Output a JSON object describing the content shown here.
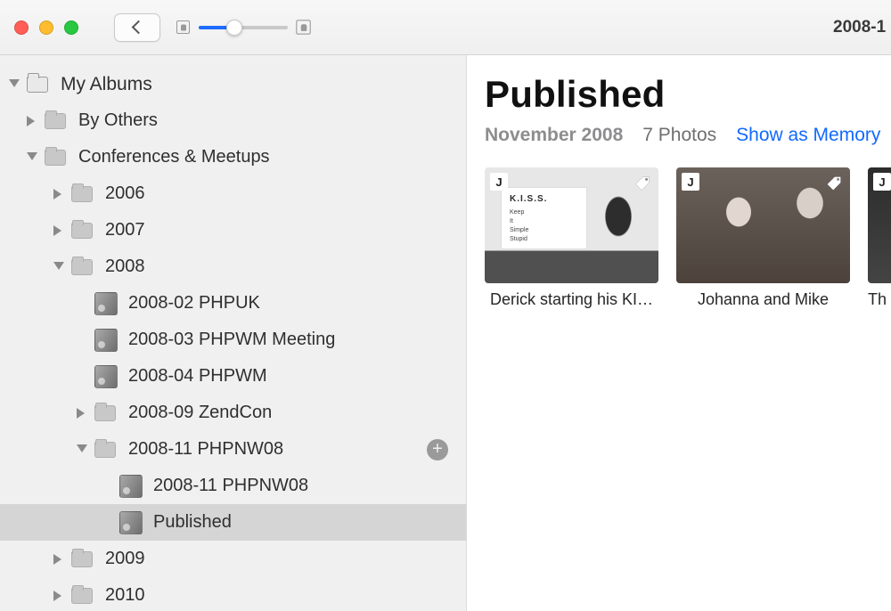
{
  "window": {
    "title_partial": "2008-1",
    "slider_percent": 40
  },
  "sidebar": {
    "header": "My Albums",
    "items": [
      {
        "label": "By Others",
        "indent": 1,
        "disclosure": "right",
        "icon": "folder"
      },
      {
        "label": "Conferences & Meetups",
        "indent": 1,
        "disclosure": "down",
        "icon": "folder"
      },
      {
        "label": "2006",
        "indent": 2,
        "disclosure": "right",
        "icon": "folder"
      },
      {
        "label": "2007",
        "indent": 2,
        "disclosure": "right",
        "icon": "folder"
      },
      {
        "label": "2008",
        "indent": 2,
        "disclosure": "down",
        "icon": "folder"
      },
      {
        "label": "2008-02 PHPUK",
        "indent": 3,
        "disclosure": "none",
        "icon": "album"
      },
      {
        "label": "2008-03 PHPWM Meeting",
        "indent": 3,
        "disclosure": "none",
        "icon": "album"
      },
      {
        "label": "2008-04 PHPWM",
        "indent": 3,
        "disclosure": "none",
        "icon": "album"
      },
      {
        "label": "2008-09 ZendCon",
        "indent": 3,
        "disclosure": "right",
        "icon": "folder"
      },
      {
        "label": "2008-11 PHPNW08",
        "indent": 3,
        "disclosure": "down",
        "icon": "folder",
        "add_button": true
      },
      {
        "label": "2008-11 PHPNW08",
        "indent": 4,
        "disclosure": "none",
        "icon": "album"
      },
      {
        "label": "Published",
        "indent": 4,
        "disclosure": "none",
        "icon": "album",
        "selected": true
      },
      {
        "label": "2009",
        "indent": 2,
        "disclosure": "right",
        "icon": "folder"
      },
      {
        "label": "2010",
        "indent": 2,
        "disclosure": "right",
        "icon": "folder"
      }
    ]
  },
  "album": {
    "title": "Published",
    "date": "November 2008",
    "count_label": "7 Photos",
    "action": "Show as Memory",
    "photos": [
      {
        "caption": "Derick starting his KI…",
        "badge": "J",
        "has_tag": true,
        "slide_title": "K.I.S.S.",
        "slide_lines": [
          "Keep",
          "It",
          "Simple",
          "Stupid"
        ]
      },
      {
        "caption": "Johanna and Mike",
        "badge": "J",
        "has_tag": true
      },
      {
        "caption": "Th",
        "badge": "J",
        "partial": true
      }
    ]
  }
}
